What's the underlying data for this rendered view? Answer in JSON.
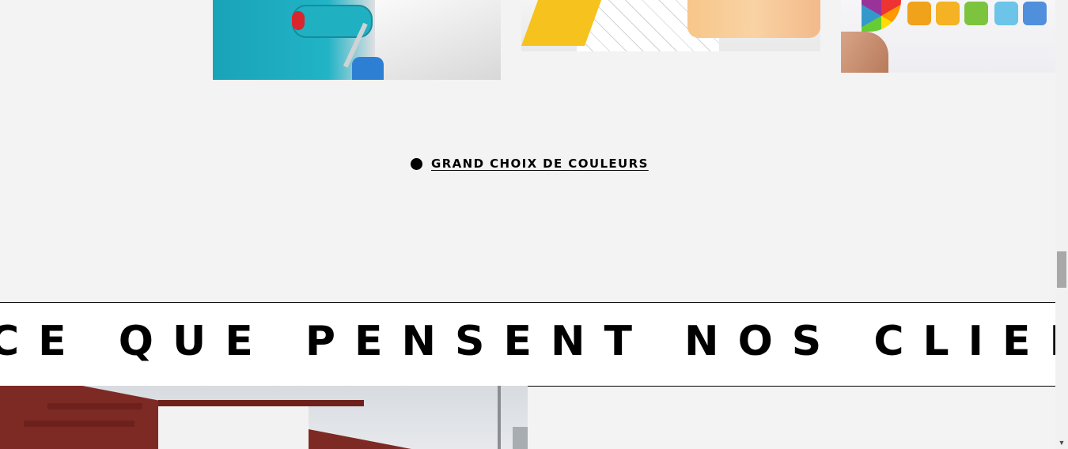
{
  "images": {
    "roller": "wall-painting-roller-image",
    "plans": "color-swatches-plans-image",
    "palette": "color-palette-hand-image",
    "house": "house-facade-image"
  },
  "feature": {
    "label": "GRAND CHOIX DE COULEURS"
  },
  "banner": {
    "text": "CE QUE PENSENT NOS CLIENTS"
  },
  "scrollbar": {
    "down_arrow": "▼"
  }
}
